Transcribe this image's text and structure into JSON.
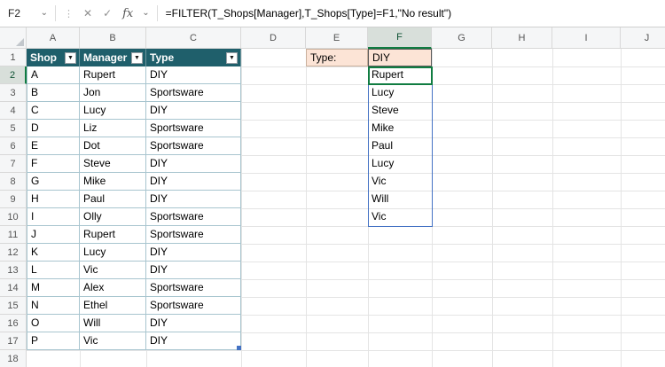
{
  "formula_bar": {
    "name_box": "F2",
    "cancel_label": "✕",
    "enter_label": "✓",
    "fx_label": "fx",
    "formula": "=FILTER(T_Shops[Manager],T_Shops[Type]=F1,\"No result\")"
  },
  "icons": {
    "dropdown": "⌄",
    "separator": "⋮",
    "filter": "▼"
  },
  "grid": {
    "column_headers": [
      "A",
      "B",
      "C",
      "D",
      "E",
      "F",
      "G",
      "H",
      "I",
      "J"
    ],
    "visible_rows": 18,
    "active_cell": "F2",
    "active_column": "F",
    "active_row": 2
  },
  "table": {
    "name": "T_Shops",
    "headers": [
      "Shop",
      "Manager",
      "Type"
    ],
    "rows": [
      [
        "A",
        "Rupert",
        "DIY"
      ],
      [
        "B",
        "Jon",
        "Sportsware"
      ],
      [
        "C",
        "Lucy",
        "DIY"
      ],
      [
        "D",
        "Liz",
        "Sportsware"
      ],
      [
        "E",
        "Dot",
        "Sportsware"
      ],
      [
        "F",
        "Steve",
        "DIY"
      ],
      [
        "G",
        "Mike",
        "DIY"
      ],
      [
        "H",
        "Paul",
        "DIY"
      ],
      [
        "I",
        "Olly",
        "Sportsware"
      ],
      [
        "J",
        "Rupert",
        "Sportsware"
      ],
      [
        "K",
        "Lucy",
        "DIY"
      ],
      [
        "L",
        "Vic",
        "DIY"
      ],
      [
        "M",
        "Alex",
        "Sportsware"
      ],
      [
        "N",
        "Ethel",
        "Sportsware"
      ],
      [
        "O",
        "Will",
        "DIY"
      ],
      [
        "P",
        "Vic",
        "DIY"
      ]
    ]
  },
  "cells": {
    "E1": "Type:",
    "F1": "DIY"
  },
  "spill": {
    "range": "F2:F10",
    "values": [
      "Rupert",
      "Lucy",
      "Steve",
      "Mike",
      "Paul",
      "Lucy",
      "Vic",
      "Will",
      "Vic"
    ]
  },
  "colors": {
    "table_header_bg": "#1F5F6B",
    "table_border": "#A8C5CF",
    "input_fill": "#FCE4D6",
    "spill_border": "#4472C4",
    "active_cell_border": "#107C41",
    "header_active_fill": "#D8DFDA"
  }
}
